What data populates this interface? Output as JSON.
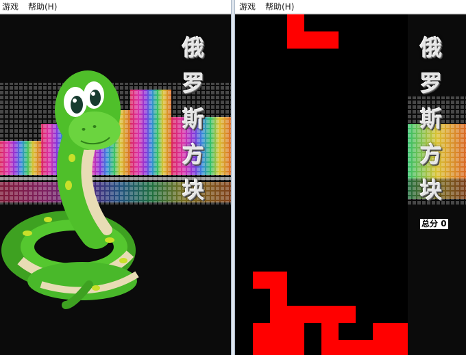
{
  "left_window": {
    "menu": [
      {
        "label": "游戏"
      },
      {
        "label": "帮助(H)"
      }
    ],
    "title_chars": [
      "俄",
      "罗",
      "斯",
      "方",
      "块"
    ],
    "mascot_icon": "green-snake"
  },
  "right_window": {
    "menu": [
      {
        "label": "游戏"
      },
      {
        "label": "帮助(H)"
      }
    ],
    "title_chars": [
      "俄",
      "罗",
      "斯",
      "方",
      "块"
    ],
    "score_label": "总分",
    "score_value": "0"
  },
  "colors": {
    "block": "#ff0000",
    "board": "#000000",
    "snake_body": "#4fbf2a",
    "snake_belly": "#e8dcb5"
  }
}
